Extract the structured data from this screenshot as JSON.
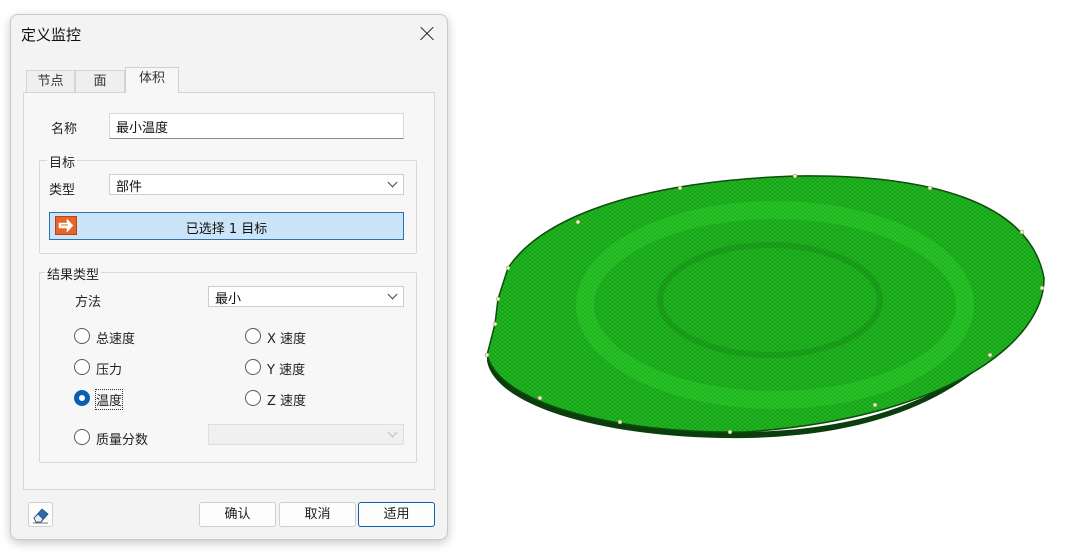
{
  "dialog": {
    "title": "定义监控",
    "tabs": [
      {
        "label": "节点",
        "active": false
      },
      {
        "label": "面",
        "active": false
      },
      {
        "label": "体积",
        "active": true
      }
    ],
    "name_label": "名称",
    "name_value": "最小温度",
    "target_group_title": "目标",
    "type_label": "类型",
    "type_value": "部件",
    "target_button_label": "已选择 1 目标",
    "result_group_title": "结果类型",
    "method_label": "方法",
    "method_value": "最小",
    "radios": [
      {
        "label": "总速度",
        "checked": false
      },
      {
        "label": "X 速度",
        "checked": false
      },
      {
        "label": "压力",
        "checked": false
      },
      {
        "label": "Y 速度",
        "checked": false
      },
      {
        "label": "温度",
        "checked": true
      },
      {
        "label": "Z 速度",
        "checked": false
      },
      {
        "label": "质量分数",
        "checked": false
      }
    ],
    "mass_fraction_value": "",
    "buttons": {
      "ok": "确认",
      "cancel": "取消",
      "apply": "适用"
    }
  },
  "colors": {
    "mesh_green": "#22c422",
    "accent_blue": "#0a5fb4",
    "target_bg": "#cce4f7",
    "target_icon": "#e8642a"
  },
  "icons": {
    "close": "close-icon",
    "target": "selection-arrow-icon",
    "eraser": "eraser-icon"
  }
}
